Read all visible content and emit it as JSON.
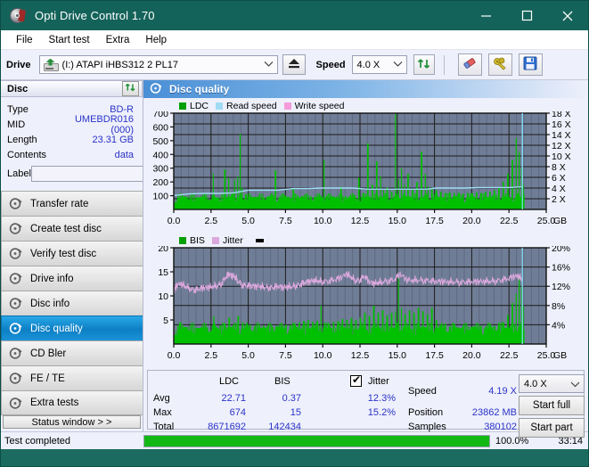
{
  "window": {
    "title": "Opti Drive Control 1.70",
    "icon": "disc-icon",
    "minimize": "–",
    "maximize": "▢",
    "close": "✕"
  },
  "menu": {
    "items": [
      "File",
      "Start test",
      "Extra",
      "Help"
    ]
  },
  "toolbar": {
    "drive_label": "Drive",
    "drive_value": "(I:)   ATAPI iHBS312   2 PL17",
    "eject_icon": "eject-icon",
    "speed_label": "Speed",
    "speed_value": "4.0 X",
    "refresh_icon": "refresh-icon",
    "eraser_icon": "eraser-icon",
    "keys_icon": "keys-icon",
    "save_icon": "save-icon"
  },
  "disc_panel": {
    "title": "Disc",
    "refresh_icon": "refresh-icon",
    "rows": [
      {
        "key": "Type",
        "value": "BD-R"
      },
      {
        "key": "MID",
        "value": "UMEBDR016 (000)"
      },
      {
        "key": "Length",
        "value": "23.31 GB"
      },
      {
        "key": "Contents",
        "value": "data"
      }
    ],
    "label_key": "Label",
    "label_value": "",
    "cd_icon": "cd-icon"
  },
  "nav": {
    "items": [
      {
        "label": "Transfer rate",
        "icon": "disc-test-icon",
        "active": false
      },
      {
        "label": "Create test disc",
        "icon": "disc-test-icon",
        "active": false
      },
      {
        "label": "Verify test disc",
        "icon": "disc-test-icon",
        "active": false
      },
      {
        "label": "Drive info",
        "icon": "disc-test-icon",
        "active": false
      },
      {
        "label": "Disc info",
        "icon": "disc-test-icon",
        "active": false
      },
      {
        "label": "Disc quality",
        "icon": "disc-test-icon",
        "active": true
      },
      {
        "label": "CD Bler",
        "icon": "disc-test-icon",
        "active": false
      },
      {
        "label": "FE / TE",
        "icon": "disc-test-icon",
        "active": false
      },
      {
        "label": "Extra tests",
        "icon": "disc-test-icon",
        "active": false
      }
    ],
    "status_window": "Status window > >"
  },
  "content": {
    "header_title": "Disc quality",
    "header_icon": "disc-quality-icon"
  },
  "stats": {
    "columns": [
      "LDC",
      "BIS"
    ],
    "jitter_label": "Jitter",
    "jitter_checked": true,
    "rows": [
      {
        "label": "Avg",
        "ldc": "22.71",
        "bis": "0.37",
        "jitter": "12.3%"
      },
      {
        "label": "Max",
        "ldc": "674",
        "bis": "15",
        "jitter": "15.2%"
      },
      {
        "label": "Total",
        "ldc": "8671692",
        "bis": "142434",
        "jitter": ""
      }
    ],
    "speed_label": "Speed",
    "speed_value": "4.19 X",
    "position_label": "Position",
    "position_value": "23862 MB",
    "samples_label": "Samples",
    "samples_value": "380102",
    "speed_select": "4.0 X",
    "start_full": "Start full",
    "start_part": "Start part"
  },
  "statusbar": {
    "message": "Test completed",
    "percent_text": "100.0%",
    "percent_value": 100,
    "elapsed": "33:14"
  },
  "colors": {
    "title_bar": "#14635a",
    "ldc_green": "#00c000",
    "read_speed_cyan": "#9fdcf4",
    "write_speed_pink": "#f49bdb",
    "jitter_pink": "#dba8dd",
    "plot_bg": "#707d96",
    "accent_blue": "#2b33c8",
    "progress_green": "#14b814"
  },
  "chart_data": [
    {
      "type": "area",
      "title": "Disc quality - LDC",
      "xlabel": "GB",
      "ylabel": "LDC",
      "xlim": [
        0,
        25
      ],
      "ylim": [
        0,
        700
      ],
      "xticks": [
        "0.0",
        "2.5",
        "5.0",
        "7.5",
        "10.0",
        "12.5",
        "15.0",
        "17.5",
        "20.0",
        "22.5",
        "25.0"
      ],
      "yticks": [
        "100",
        "200",
        "300",
        "400",
        "500",
        "600",
        "700"
      ],
      "y2label": "Speed",
      "y2lim": [
        0,
        18
      ],
      "y2ticks": [
        "2 X",
        "4 X",
        "6 X",
        "8 X",
        "10 X",
        "12 X",
        "14 X",
        "16 X",
        "18 X"
      ],
      "grid": true,
      "legend": [
        "LDC",
        "Read speed",
        "Write speed"
      ],
      "legend_position": "top-left",
      "series": [
        {
          "name": "LDC",
          "color": "#00c000",
          "kind": "spike-area",
          "x": [
            0.0,
            0.3,
            0.6,
            0.9,
            1.2,
            1.5,
            1.8,
            2.1,
            2.4,
            2.6,
            2.7,
            3.0,
            3.3,
            3.6,
            3.8,
            4.0,
            4.2,
            4.4,
            4.5,
            4.7,
            5.0,
            5.3,
            5.6,
            5.9,
            6.2,
            6.5,
            6.7,
            7.0,
            7.3,
            7.6,
            7.9,
            8.2,
            8.5,
            8.8,
            9.1,
            9.4,
            9.7,
            10.0,
            10.2,
            10.5,
            10.8,
            11.1,
            11.4,
            11.7,
            12.0,
            12.3,
            12.6,
            12.9,
            13.2,
            13.5,
            13.8,
            14.0,
            14.2,
            14.5,
            14.8,
            15.0,
            15.2,
            15.4,
            15.6,
            15.9,
            16.2,
            16.5,
            16.8,
            17.0,
            17.2,
            17.5,
            17.8,
            18.1,
            18.4,
            18.7,
            19.0,
            19.3,
            19.6,
            19.9,
            20.2,
            20.5,
            20.8,
            21.1,
            21.4,
            21.7,
            22.0,
            22.3,
            22.6,
            22.9,
            23.1,
            23.3,
            23.4,
            23.5
          ],
          "y": [
            60,
            70,
            65,
            60,
            58,
            62,
            60,
            65,
            70,
            260,
            80,
            75,
            290,
            230,
            120,
            215,
            240,
            550,
            160,
            110,
            95,
            90,
            92,
            88,
            95,
            90,
            285,
            95,
            100,
            92,
            150,
            98,
            95,
            92,
            95,
            90,
            98,
            360,
            100,
            95,
            92,
            165,
            98,
            95,
            100,
            230,
            120,
            480,
            180,
            350,
            240,
            140,
            160,
            130,
            700,
            220,
            300,
            180,
            260,
            150,
            200,
            420,
            260,
            170,
            150,
            140,
            130,
            120,
            125,
            118,
            122,
            115,
            120,
            118,
            125,
            120,
            128,
            130,
            140,
            160,
            200,
            260,
            360,
            520,
            420,
            300,
            180,
            0
          ]
        },
        {
          "name": "Read speed",
          "color": "#9fdcf4",
          "kind": "line",
          "x": [
            0.0,
            1.0,
            2.0,
            3.0,
            4.0,
            5.0,
            6.0,
            7.0,
            8.0,
            9.0,
            10.0,
            11.0,
            12.0,
            13.0,
            14.0,
            15.0,
            16.0,
            17.0,
            17.6,
            18.5,
            19.5,
            20.5,
            21.5,
            22.5,
            23.2,
            23.4,
            23.4,
            23.4
          ],
          "y": [
            2.6,
            2.9,
            3.0,
            3.0,
            3.1,
            3.6,
            3.6,
            3.6,
            3.9,
            3.9,
            4.0,
            4.0,
            4.0,
            3.8,
            3.8,
            3.8,
            3.8,
            3.8,
            4.0,
            4.0,
            4.0,
            4.1,
            4.1,
            4.1,
            4.2,
            4.2,
            9.5,
            18.0
          ]
        },
        {
          "name": "Write speed",
          "color": "#f49bdb",
          "kind": "line",
          "x": [],
          "y": []
        }
      ]
    },
    {
      "type": "area",
      "title": "Disc quality - BIS / Jitter",
      "xlabel": "GB",
      "ylabel": "BIS",
      "xlim": [
        0,
        25
      ],
      "ylim": [
        0,
        20
      ],
      "xticks": [
        "0.0",
        "2.5",
        "5.0",
        "7.5",
        "10.0",
        "12.5",
        "15.0",
        "17.5",
        "20.0",
        "22.5",
        "25.0"
      ],
      "yticks": [
        "5",
        "10",
        "15",
        "20"
      ],
      "y2label": "Jitter",
      "y2lim": [
        0,
        20
      ],
      "y2ticks": [
        "4%",
        "8%",
        "12%",
        "16%",
        "20%"
      ],
      "grid": true,
      "legend": [
        "BIS",
        "Jitter"
      ],
      "legend_position": "top-left",
      "series": [
        {
          "name": "BIS",
          "color": "#00c000",
          "kind": "spike-area",
          "x": [
            0.0,
            0.3,
            0.6,
            0.9,
            1.2,
            1.5,
            1.8,
            2.1,
            2.4,
            2.6,
            2.8,
            3.0,
            3.3,
            3.6,
            3.9,
            4.2,
            4.5,
            4.8,
            5.0,
            5.3,
            5.6,
            5.9,
            6.2,
            6.5,
            6.8,
            7.1,
            7.4,
            7.7,
            8.0,
            8.3,
            8.6,
            8.9,
            9.2,
            9.5,
            9.8,
            10.0,
            10.3,
            10.6,
            10.9,
            11.2,
            11.5,
            11.8,
            12.1,
            12.4,
            12.7,
            13.0,
            13.3,
            13.6,
            13.9,
            14.2,
            14.5,
            14.8,
            15.0,
            15.2,
            15.4,
            15.7,
            16.0,
            16.3,
            16.6,
            16.9,
            17.2,
            17.5,
            17.8,
            18.1,
            18.4,
            18.7,
            19.0,
            19.3,
            19.6,
            19.9,
            20.2,
            20.5,
            20.8,
            21.1,
            21.4,
            21.7,
            22.0,
            22.3,
            22.6,
            22.9,
            23.1,
            23.3,
            23.4,
            23.5
          ],
          "y": [
            3.0,
            4.5,
            3.5,
            3.0,
            3.2,
            2.8,
            3.0,
            3.4,
            3.2,
            5.8,
            3.5,
            3.8,
            4.2,
            5.5,
            4.0,
            5.8,
            4.5,
            3.8,
            4.0,
            3.6,
            3.5,
            3.8,
            3.6,
            3.5,
            3.8,
            3.6,
            4.0,
            3.8,
            4.2,
            4.5,
            4.8,
            5.0,
            4.6,
            4.8,
            8.0,
            4.5,
            4.2,
            4.6,
            4.8,
            5.2,
            5.0,
            5.4,
            5.0,
            5.5,
            6.5,
            5.8,
            8.0,
            6.5,
            7.0,
            6.0,
            6.5,
            6.8,
            14.5,
            7.5,
            6.2,
            7.0,
            6.5,
            7.5,
            6.8,
            6.2,
            7.5,
            5.0,
            3.8,
            4.2,
            3.6,
            4.0,
            3.4,
            3.8,
            3.2,
            3.6,
            3.4,
            3.8,
            3.5,
            4.0,
            3.8,
            4.4,
            4.6,
            6.0,
            8.5,
            10.5,
            14.0,
            12.0,
            8.0,
            0
          ]
        },
        {
          "name": "Jitter",
          "color": "#dba8dd",
          "kind": "line-noisy",
          "x": [
            0.0,
            0.2,
            0.5,
            0.8,
            1.1,
            1.4,
            1.7,
            2.0,
            2.3,
            2.6,
            2.9,
            3.2,
            3.5,
            3.7,
            3.9,
            4.1,
            4.3,
            4.6,
            4.9,
            5.2,
            5.5,
            5.8,
            6.1,
            6.4,
            6.7,
            7.0,
            7.3,
            7.6,
            7.9,
            8.2,
            8.5,
            8.8,
            9.1,
            9.4,
            9.7,
            10.0,
            10.4,
            10.8,
            11.2,
            11.6,
            11.9,
            12.2,
            12.5,
            12.8,
            13.1,
            13.4,
            13.7,
            14.0,
            14.4,
            14.8,
            15.2,
            15.6,
            16.0,
            16.4,
            16.8,
            17.2,
            17.6,
            18.0,
            18.4,
            18.8,
            19.2,
            19.6,
            20.0,
            20.4,
            20.8,
            21.2,
            21.6,
            22.0,
            22.4,
            22.8,
            23.1,
            23.4
          ],
          "y": [
            10.9,
            12.3,
            12.5,
            12.0,
            11.6,
            11.3,
            11.5,
            11.7,
            11.8,
            12.0,
            12.2,
            12.6,
            14.0,
            14.6,
            14.2,
            14.0,
            13.2,
            12.3,
            12.2,
            12.1,
            12.0,
            12.0,
            11.9,
            11.8,
            11.9,
            12.0,
            11.8,
            11.9,
            12.0,
            12.2,
            12.5,
            12.8,
            13.0,
            13.2,
            13.2,
            13.0,
            13.2,
            13.4,
            13.8,
            14.6,
            14.0,
            13.2,
            13.4,
            14.2,
            13.0,
            12.6,
            12.8,
            13.0,
            13.2,
            13.4,
            14.6,
            13.4,
            13.2,
            13.4,
            13.3,
            13.2,
            13.0,
            13.0,
            12.9,
            13.0,
            12.9,
            13.0,
            12.9,
            13.0,
            13.0,
            13.1,
            13.2,
            13.4,
            13.6,
            14.0,
            14.2,
            13.4
          ]
        }
      ]
    }
  ]
}
